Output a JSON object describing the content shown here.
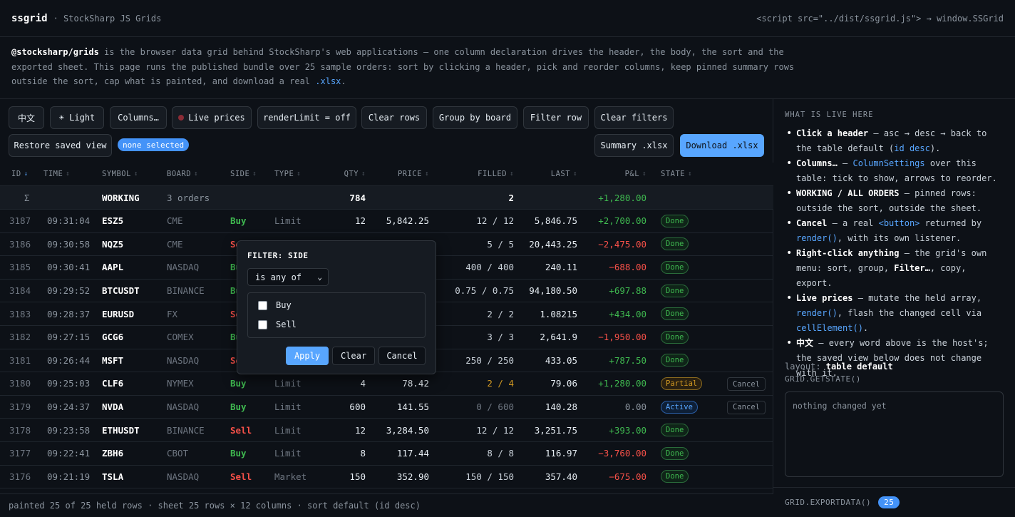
{
  "header": {
    "brand": "ssgrid",
    "brand_sub": "· StockSharp JS Grids",
    "script_hint": "<script src=\"../dist/ssgrid.js\"> → window.SSGrid"
  },
  "intro": {
    "package": "@stocksharp/grids",
    "text_1": " is the browser data grid behind StockSharp's web applications — one column declaration drives the header, the body, the sort and the",
    "text_2": "exported sheet. This page runs the published bundle over 25 sample orders: sort by clicking a header, pick and reorder columns, keep pinned summary rows",
    "text_3": "outside the sort, cap what is painted, and download a real ",
    "xlsx": ".xlsx",
    "end": "."
  },
  "toolbar": {
    "lang": "中文",
    "theme": "☀ Light",
    "columns": "Columns…",
    "live": "Live prices",
    "render_limit": "renderLimit = off",
    "clear_rows": "Clear rows",
    "group_board": "Group by board",
    "filter_row": "Filter row",
    "clear_filters": "Clear filters",
    "restore_view": "Restore saved view",
    "selection": "none selected",
    "summary_xlsx": "Summary .xlsx",
    "download_xlsx": "Download .xlsx"
  },
  "grid": {
    "columns": [
      "ID",
      "TIME",
      "SYMBOL",
      "BOARD",
      "SIDE",
      "TYPE",
      "QTY",
      "PRICE",
      "FILLED",
      "LAST",
      "P&L",
      "STATE"
    ],
    "sort_active_arrow": "↓",
    "sort_idle_arrow": "↕",
    "summary": {
      "sigma": "Σ",
      "label": "WORKING",
      "orders": "3 orders",
      "qty": "784",
      "filled": "2",
      "pnl": "+1,280.00"
    },
    "rows": [
      {
        "id": "3187",
        "time": "09:31:04",
        "symbol": "ESZ5",
        "board": "CME",
        "side": "Buy",
        "type": "Limit",
        "qty": "12",
        "price": "5,842.25",
        "filled": "12 / 12",
        "last": "5,846.75",
        "pnl": "+2,700.00",
        "state": "Done",
        "action": ""
      },
      {
        "id": "3186",
        "time": "09:30:58",
        "symbol": "NQZ5",
        "board": "CME",
        "side": "Sell",
        "type": "Limit",
        "qty": "",
        "price": "",
        "filled": "5 / 5",
        "last": "20,443.25",
        "pnl": "−2,475.00",
        "state": "Done",
        "action": ""
      },
      {
        "id": "3185",
        "time": "09:30:41",
        "symbol": "AAPL",
        "board": "NASDAQ",
        "side": "Buy",
        "type": "",
        "qty": "",
        "price": "",
        "filled": "400 / 400",
        "last": "240.11",
        "pnl": "−688.00",
        "state": "Done",
        "action": ""
      },
      {
        "id": "3184",
        "time": "09:29:52",
        "symbol": "BTCUSDT",
        "board": "BINANCE",
        "side": "Buy",
        "type": "",
        "qty": "",
        "price": "",
        "filled": "0.75 / 0.75",
        "last": "94,180.50",
        "pnl": "+697.88",
        "state": "Done",
        "action": ""
      },
      {
        "id": "3183",
        "time": "09:28:37",
        "symbol": "EURUSD",
        "board": "FX",
        "side": "Sell",
        "type": "",
        "qty": "",
        "price": "",
        "filled": "2 / 2",
        "last": "1.08215",
        "pnl": "+434.00",
        "state": "Done",
        "action": ""
      },
      {
        "id": "3182",
        "time": "09:27:15",
        "symbol": "GCG6",
        "board": "COMEX",
        "side": "Buy",
        "type": "",
        "qty": "",
        "price": "",
        "filled": "3 / 3",
        "last": "2,641.9",
        "pnl": "−1,950.00",
        "state": "Done",
        "action": ""
      },
      {
        "id": "3181",
        "time": "09:26:44",
        "symbol": "MSFT",
        "board": "NASDAQ",
        "side": "Sell",
        "type": "",
        "qty": "",
        "price": "",
        "filled": "250 / 250",
        "last": "433.05",
        "pnl": "+787.50",
        "state": "Done",
        "action": ""
      },
      {
        "id": "3180",
        "time": "09:25:03",
        "symbol": "CLF6",
        "board": "NYMEX",
        "side": "Buy",
        "type": "Limit",
        "qty": "4",
        "price": "78.42",
        "filled": "2 / 4",
        "last": "79.06",
        "pnl": "+1,280.00",
        "state": "Partial",
        "action": "Cancel"
      },
      {
        "id": "3179",
        "time": "09:24:37",
        "symbol": "NVDA",
        "board": "NASDAQ",
        "side": "Buy",
        "type": "Limit",
        "qty": "600",
        "price": "141.55",
        "filled": "0 / 600",
        "last": "140.28",
        "pnl": "0.00",
        "state": "Active",
        "action": "Cancel"
      },
      {
        "id": "3178",
        "time": "09:23:58",
        "symbol": "ETHUSDT",
        "board": "BINANCE",
        "side": "Sell",
        "type": "Limit",
        "qty": "12",
        "price": "3,284.50",
        "filled": "12 / 12",
        "last": "3,251.75",
        "pnl": "+393.00",
        "state": "Done",
        "action": ""
      },
      {
        "id": "3177",
        "time": "09:22:41",
        "symbol": "ZBH6",
        "board": "CBOT",
        "side": "Buy",
        "type": "Limit",
        "qty": "8",
        "price": "117.44",
        "filled": "8 / 8",
        "last": "116.97",
        "pnl": "−3,760.00",
        "state": "Done",
        "action": ""
      },
      {
        "id": "3176",
        "time": "09:21:19",
        "symbol": "TSLA",
        "board": "NASDAQ",
        "side": "Sell",
        "type": "Market",
        "qty": "150",
        "price": "352.90",
        "filled": "150 / 150",
        "last": "357.40",
        "pnl": "−675.00",
        "state": "Done",
        "action": ""
      }
    ]
  },
  "footer": {
    "status": "painted 25 of 25 held rows · sheet 25 rows × 12 columns · sort default (id desc)"
  },
  "filter_popup": {
    "title": "FILTER: SIDE",
    "operator": "is any of",
    "options": [
      "Buy",
      "Sell"
    ],
    "apply": "Apply",
    "clear": "Clear",
    "cancel": "Cancel"
  },
  "sidebar": {
    "title": "WHAT IS LIVE HERE",
    "layout_label": "layout: ",
    "layout_value": "table default",
    "getstate_label": "GRID.GETSTATE()",
    "getstate_value": "nothing changed yet",
    "export_label": "GRID.EXPORTDATA()",
    "export_count": "25"
  },
  "colors": {
    "background": "#0d1117",
    "accent": "#58a6ff",
    "buy": "#3fb950",
    "sell": "#f85149",
    "partial": "#d29922"
  }
}
